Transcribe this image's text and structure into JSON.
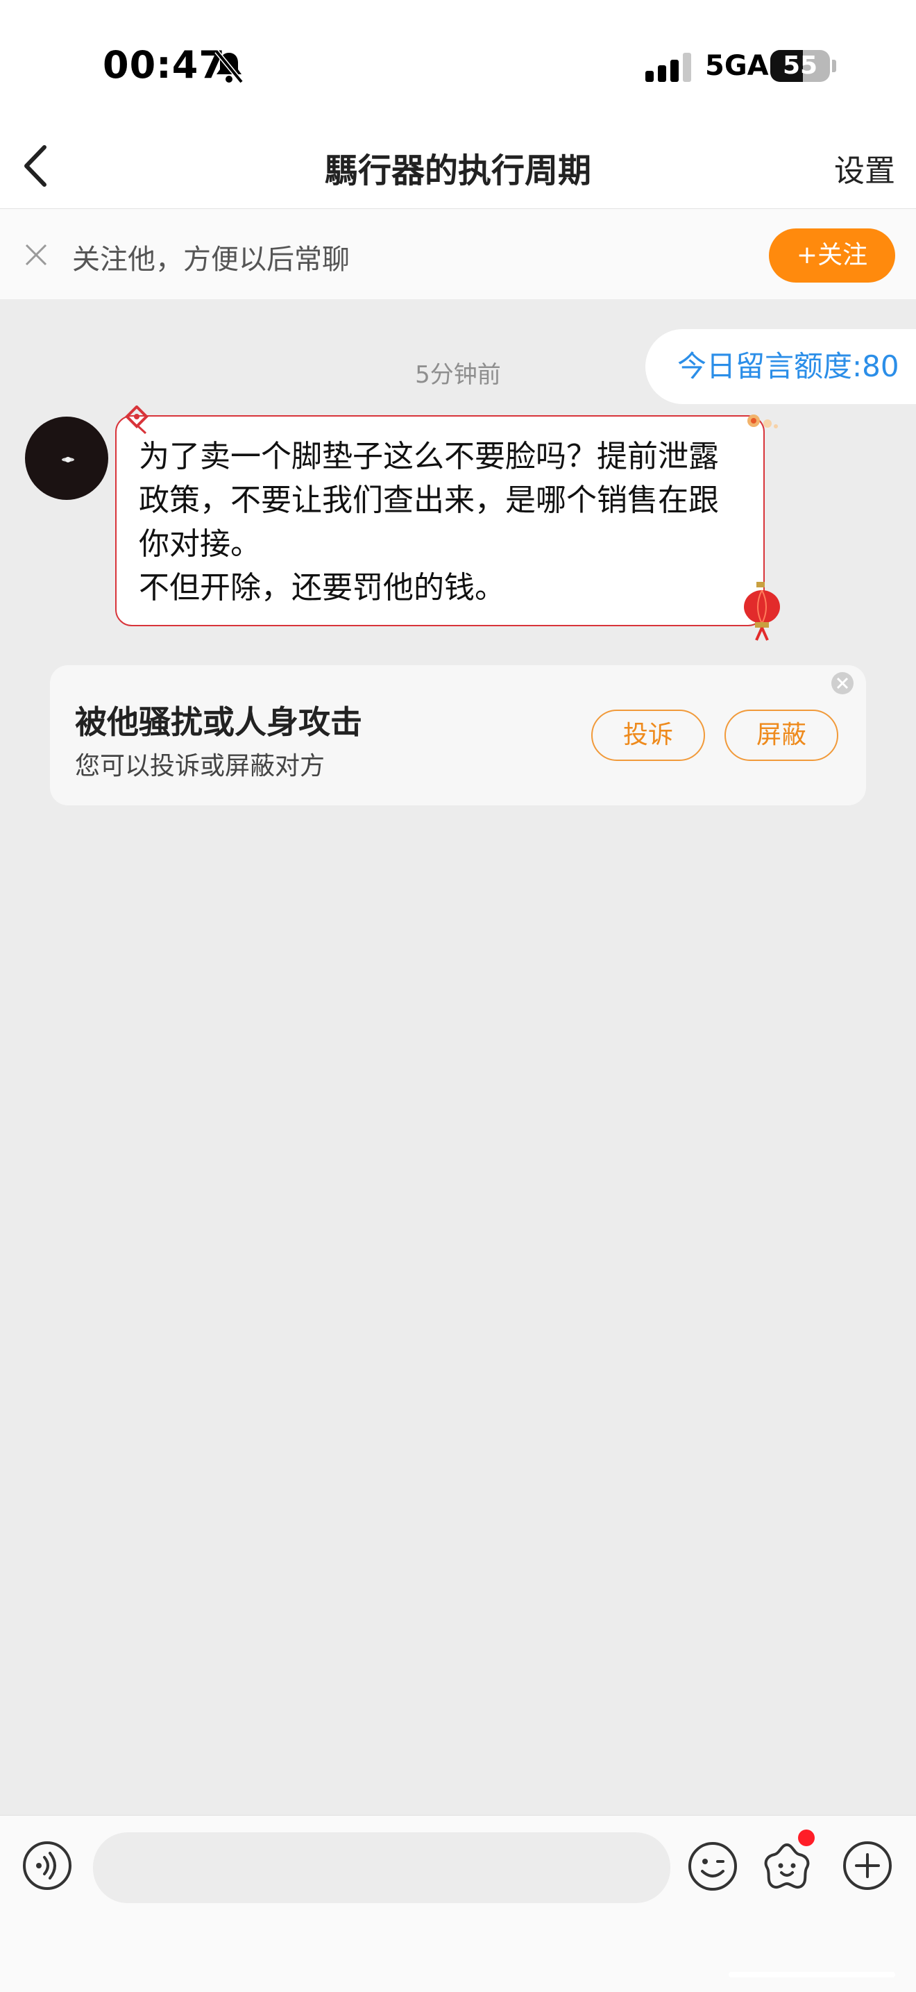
{
  "status_bar": {
    "time": "00:47",
    "network": "5GA",
    "battery": "55",
    "battery_level": 0.55
  },
  "nav": {
    "title": "騳行器的执行周期",
    "settings_label": "设置"
  },
  "follow_bar": {
    "text": "关注他，方便以后常聊",
    "button_label": "+关注"
  },
  "chat": {
    "quota_label": "今日留言额度:80",
    "timestamp": "5分钟前",
    "message": "为了卖一个脚垫子这么不要脸吗？提前泄露政策，不要让我们查出来，是哪个销售在跟你对接。\n不但开除，还要罚他的钱。"
  },
  "report_card": {
    "title": "被他骚扰或人身攻击",
    "subtitle": "您可以投诉或屏蔽对方",
    "complain_label": "投诉",
    "block_label": "屏蔽"
  },
  "input_bar": {
    "placeholder": "",
    "icons": [
      "voice-icon",
      "emoji-icon",
      "sticker-icon",
      "plus-icon"
    ],
    "sticker_badge_color": "#ff1d27"
  },
  "colors": {
    "accent_orange": "#ff8a0d",
    "link_blue": "#2b8ee8",
    "bubble_border": "#d8343a"
  }
}
